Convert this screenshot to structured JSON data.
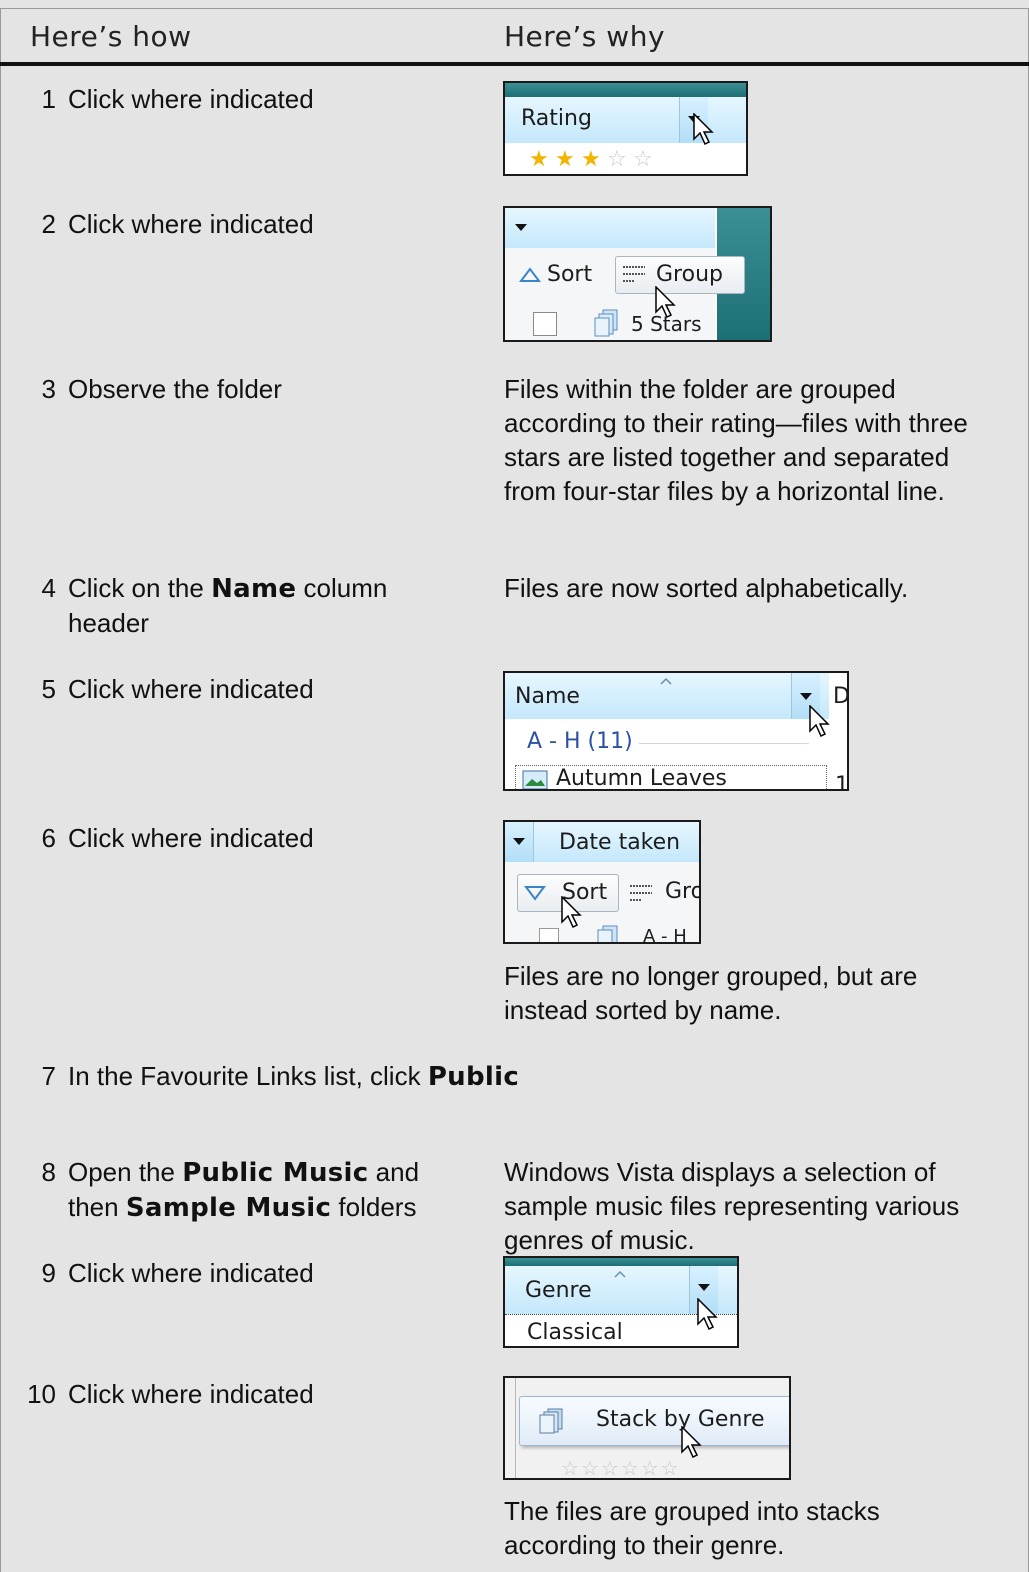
{
  "header": {
    "how": "Here’s how",
    "why": "Here’s why"
  },
  "steps": [
    {
      "num": "1",
      "how": "Click where indicated"
    },
    {
      "num": "2",
      "how": "Click where indicated"
    },
    {
      "num": "3",
      "how": "Observe the folder",
      "why": "Files within the folder are grouped according to their rating—files with three stars are listed together and separated from four-star files by a horizontal line."
    },
    {
      "num": "4",
      "how_pre": "Click on the ",
      "how_bold": "Name",
      "how_post": " column header",
      "why": "Files are now sorted alphabetically."
    },
    {
      "num": "5",
      "how": "Click where indicated"
    },
    {
      "num": "6",
      "how": "Click where indicated",
      "why": "Files are no longer grouped, but are instead sorted by name."
    },
    {
      "num": "7",
      "how_pre": "In the Favourite Links list, click ",
      "how_bold": "Public"
    },
    {
      "num": "8",
      "how_pre": "Open the ",
      "how_bold": "Public Music",
      "how_mid": " and then ",
      "how_bold2": "Sample Music",
      "how_post": " folders",
      "why": "Windows Vista displays a selection of sample music files representing various genres of music."
    },
    {
      "num": "9",
      "how": "Click where indicated"
    },
    {
      "num": "10",
      "how": "Click where indicated",
      "why": "The files are grouped into stacks according to their genre."
    }
  ],
  "screenshots": {
    "s1": {
      "column": "Rating",
      "stars_filled": 3,
      "stars_total": 5
    },
    "s2": {
      "sort": "Sort",
      "group": "Group",
      "item": "5 Stars"
    },
    "s5": {
      "column": "Name",
      "group": "A - H (11)",
      "item": "Autumn Leaves",
      "next_col": "D",
      "next_val": "1"
    },
    "s6": {
      "column": "Date taken",
      "sort": "Sort",
      "group": "Gro",
      "item": "A - H"
    },
    "s9": {
      "column": "Genre",
      "item": "Classical"
    },
    "s10": {
      "menu": "Stack by Genre"
    }
  }
}
